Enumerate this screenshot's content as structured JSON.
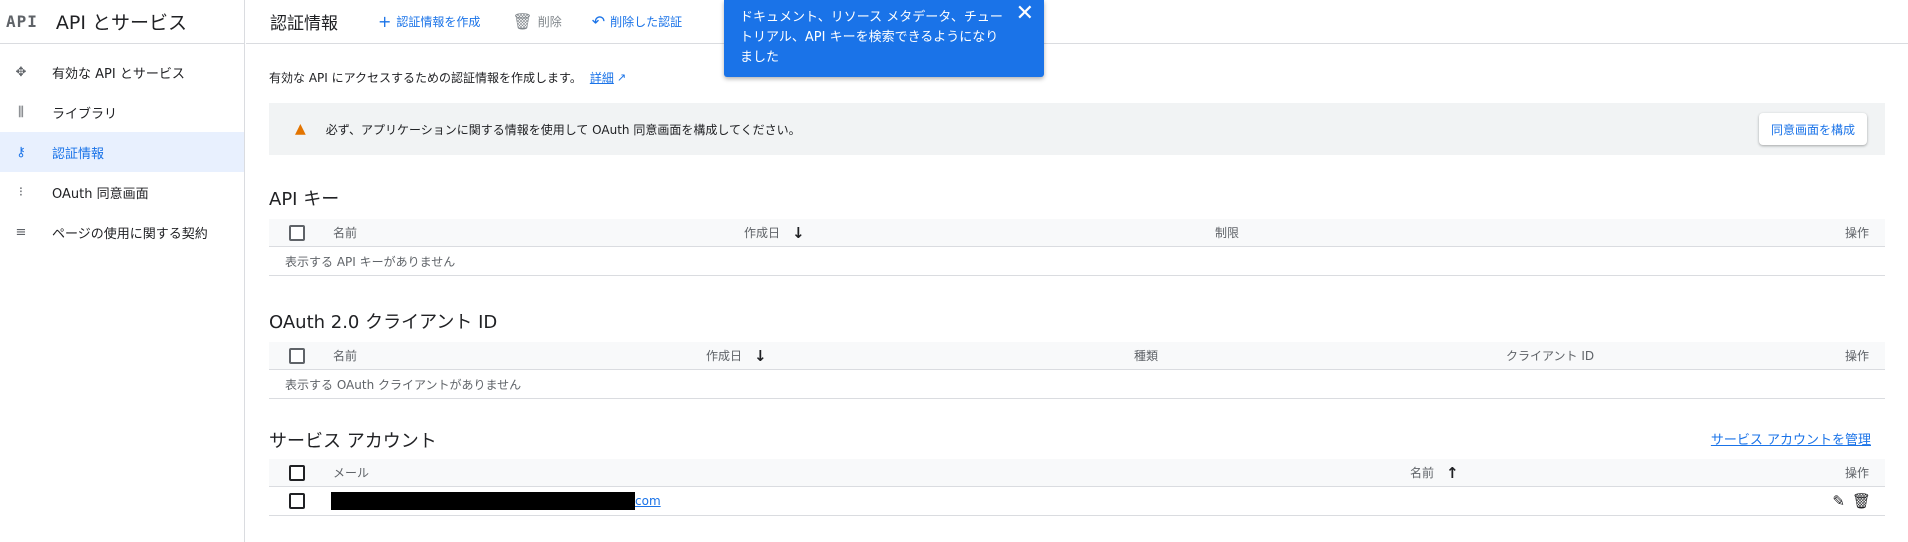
{
  "sidebar": {
    "logo": "API",
    "title": "API とサービス",
    "items": [
      {
        "label": "有効な API とサービス",
        "icon": "✥"
      },
      {
        "label": "ライブラリ",
        "icon": "⫼"
      },
      {
        "label": "認証情報",
        "icon": "⚷"
      },
      {
        "label": "OAuth 同意画面",
        "icon": "⁝"
      },
      {
        "label": "ページの使用に関する契約",
        "icon": "≡"
      }
    ]
  },
  "toolbar": {
    "title": "認証情報",
    "create_label": "認証情報を作成",
    "delete_label": "削除",
    "restore_label": "削除した認証",
    "icons": {
      "create": "+",
      "delete": "🗑",
      "restore": "↶"
    }
  },
  "toast": {
    "text": "ドキュメント、リソース メタデータ、チュートリアル、API キーを検索できるようになりました",
    "close": "✕"
  },
  "intro": {
    "text": "有効な API にアクセスするための認証情報を作成します。",
    "link": "詳細"
  },
  "banner": {
    "text": "必ず、アプリケーションに関する情報を使用して OAuth 同意画面を構成してください。",
    "button": "同意画面を構成",
    "warn_color": "#e37400"
  },
  "api_keys": {
    "title": "API キー",
    "cols": {
      "name": "名前",
      "created": "作成日",
      "restrict": "制限",
      "ops": "操作"
    },
    "empty": "表示する API キーがありません"
  },
  "oauth": {
    "title": "OAuth 2.0 クライアント ID",
    "cols": {
      "name": "名前",
      "created": "作成日",
      "type": "種類",
      "client": "クライアント ID",
      "ops": "操作"
    },
    "empty": "表示する OAuth クライアントがありません"
  },
  "service_accounts": {
    "title": "サービス アカウント",
    "manage_link": "サービス アカウントを管理",
    "cols": {
      "email": "メール",
      "name": "名前",
      "ops": "操作"
    },
    "rows": [
      {
        "email_suffix": "com"
      }
    ]
  },
  "colors": {
    "accent": "#1a73e8",
    "toast": "#1a73e8",
    "active_bg": "#e8f0fe"
  }
}
